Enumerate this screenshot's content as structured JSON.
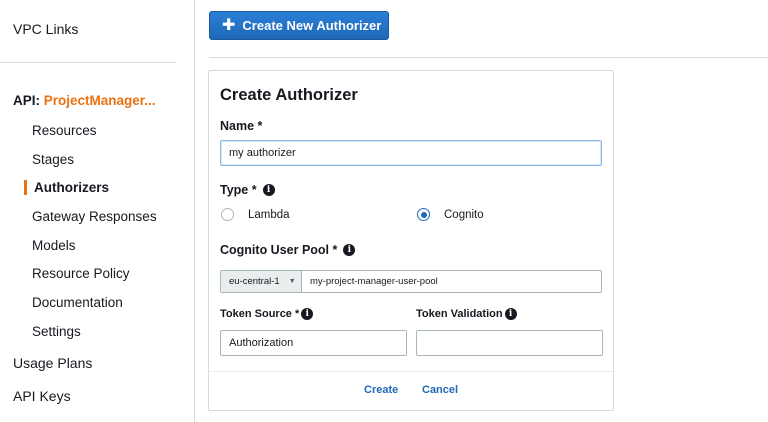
{
  "sidebar": {
    "top_item": "VPC Links",
    "api_prefix": "API:",
    "api_name": "ProjectManager...",
    "items": [
      {
        "label": "Resources"
      },
      {
        "label": "Stages"
      },
      {
        "label": "Authorizers"
      },
      {
        "label": "Gateway Responses"
      },
      {
        "label": "Models"
      },
      {
        "label": "Resource Policy"
      },
      {
        "label": "Documentation"
      },
      {
        "label": "Settings"
      }
    ],
    "active_item": "Authorizers",
    "bottom_items": [
      {
        "label": "Usage Plans"
      },
      {
        "label": "API Keys"
      }
    ]
  },
  "toolbar": {
    "create_new_label": "Create New Authorizer",
    "create_new_icon": "plus-icon"
  },
  "form": {
    "title": "Create Authorizer",
    "name_label": "Name *",
    "name_value": "my authorizer",
    "type_label": "Type *",
    "type_options": [
      "Lambda",
      "Cognito"
    ],
    "type_selected": "Cognito",
    "pool_label": "Cognito User Pool *",
    "region_value": "eu-central-1",
    "pool_value": "my-project-manager-user-pool",
    "token_source_label": "Token Source *",
    "token_source_value": "Authorization",
    "token_validation_label": "Token Validation",
    "token_validation_value": "",
    "create_label": "Create",
    "cancel_label": "Cancel"
  },
  "colors": {
    "accent_orange": "#ec7211",
    "primary_blue": "#1f68b8",
    "border": "#d5dbdb"
  }
}
